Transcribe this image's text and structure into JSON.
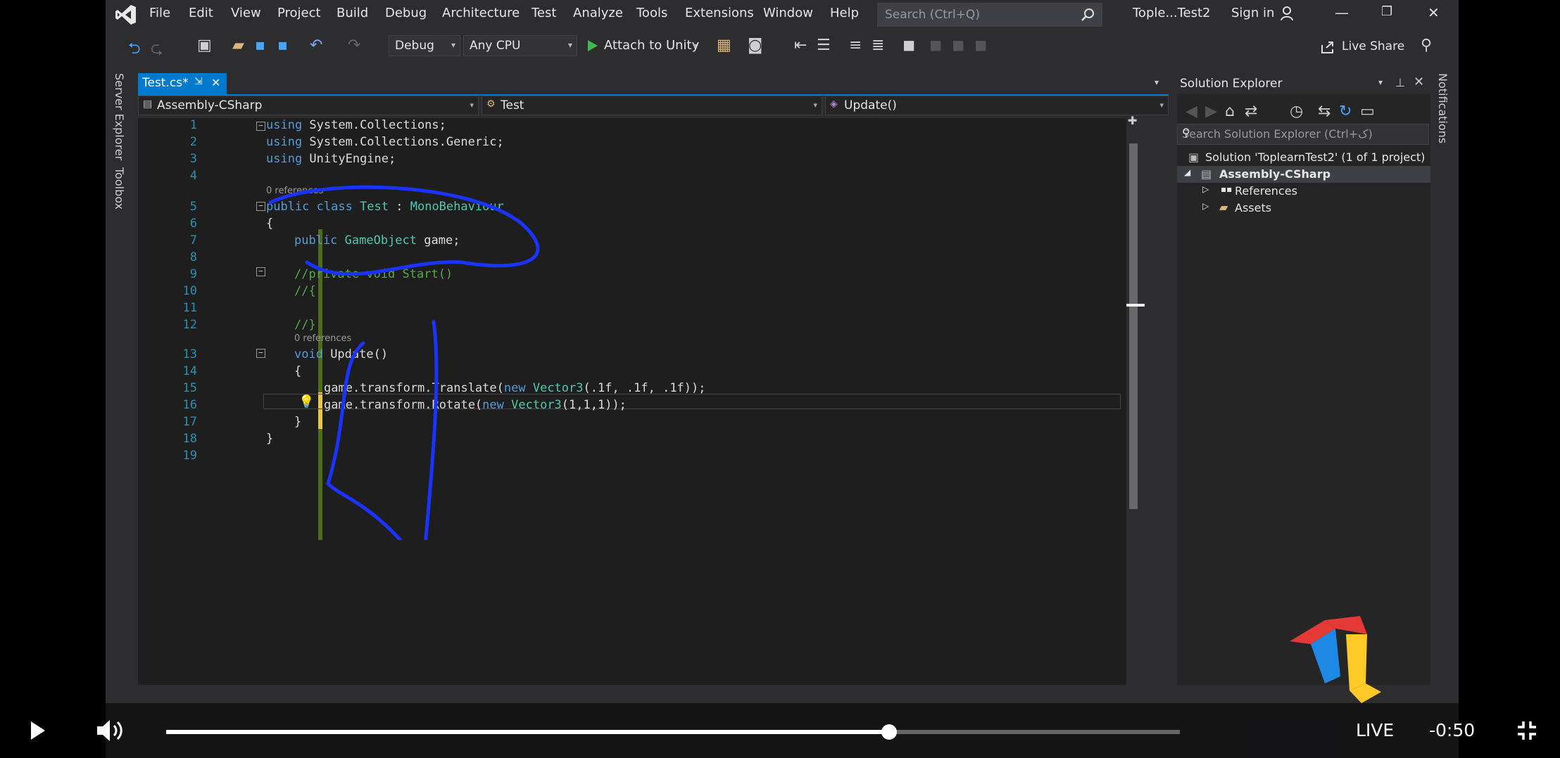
{
  "menu": [
    "File",
    "Edit",
    "View",
    "Project",
    "Build",
    "Debug",
    "Architecture",
    "Test",
    "Analyze",
    "Tools",
    "Extensions",
    "Window",
    "Help"
  ],
  "search_placeholder": "Search (Ctrl+Q)",
  "solution_title": "Tople...Test2",
  "sign_in": "Sign in",
  "toolbar": {
    "config": "Debug",
    "platform": "Any CPU",
    "attach": "Attach to Unity",
    "live_share": "Live Share"
  },
  "side_tabs": {
    "server_explorer": "Server Explorer",
    "toolbox": "Toolbox",
    "notifications": "Notifications"
  },
  "tab": {
    "file": "Test.cs*",
    "pin": "⇲",
    "close": "✕"
  },
  "nav": {
    "project": "Assembly-CSharp",
    "class": "Test",
    "member": "Update()"
  },
  "lens": {
    "class_refs": "0 references",
    "update_refs": "0 references"
  },
  "code": {
    "l1": {
      "n": "1",
      "kw": "using",
      "rest": " System.Collections;"
    },
    "l2": {
      "n": "2",
      "kw": "using",
      "rest": " System.Collections.Generic;"
    },
    "l3": {
      "n": "3",
      "kw": "using",
      "rest": " UnityEngine;"
    },
    "l4": {
      "n": "4"
    },
    "l5": {
      "n": "5",
      "a": "public class ",
      "b": "Test",
      "c": " : ",
      "d": "MonoBehaviour"
    },
    "l6": {
      "n": "6",
      "t": "{"
    },
    "l7": {
      "n": "7",
      "a": "public ",
      "b": "GameObject",
      "c": " game;"
    },
    "l8": {
      "n": "8"
    },
    "l9": {
      "n": "9",
      "t": "//private void Start()"
    },
    "l10": {
      "n": "10",
      "t": "//{"
    },
    "l11": {
      "n": "11"
    },
    "l12": {
      "n": "12",
      "t": "//}"
    },
    "l13": {
      "n": "13",
      "a": "void",
      "b": " Update()"
    },
    "l14": {
      "n": "14",
      "t": "{"
    },
    "l15": {
      "n": "15",
      "a": "game.transform.Translate(",
      "b": "new",
      "c": " ",
      "d": "Vector3",
      "e": "(.1f, .1f, .1f));"
    },
    "l16": {
      "n": "16",
      "a": "game.transform.Rotate(",
      "b": "new",
      "c": " ",
      "d": "Vector3",
      "e": "(1,1,1));"
    },
    "l17": {
      "n": "17",
      "t": "}"
    },
    "l18": {
      "n": "18",
      "t": "}"
    },
    "l19": {
      "n": "19"
    }
  },
  "solution_explorer": {
    "title": "Solution Explorer",
    "search_placeholder": "Search Solution Explorer (Ctrl+ک)",
    "solution": "Solution 'ToplearnTest2' (1 of 1 project)",
    "project": "Assembly-CSharp",
    "references": "References",
    "assets": "Assets"
  },
  "player": {
    "live": "LIVE",
    "time": "-0:50",
    "progress": 0.713
  }
}
